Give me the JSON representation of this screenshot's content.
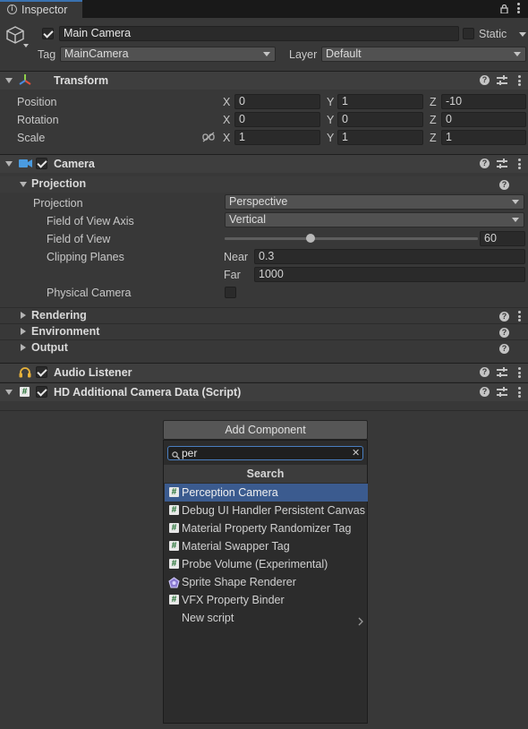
{
  "tab": {
    "title": "Inspector"
  },
  "gameobject": {
    "active": true,
    "name": "Main Camera",
    "static_label": "Static",
    "static_checked": false,
    "tag_label": "Tag",
    "tag_value": "MainCamera",
    "layer_label": "Layer",
    "layer_value": "Default"
  },
  "transform": {
    "title": "Transform",
    "rows": [
      {
        "label": "Position",
        "x": "0",
        "y": "1",
        "z": "-10"
      },
      {
        "label": "Rotation",
        "x": "0",
        "y": "0",
        "z": "0"
      },
      {
        "label": "Scale",
        "x": "1",
        "y": "1",
        "z": "1"
      }
    ],
    "axis": {
      "x": "X",
      "y": "Y",
      "z": "Z"
    }
  },
  "camera": {
    "title": "Camera",
    "enabled": true,
    "projection_section": "Projection",
    "projection_label": "Projection",
    "projection_value": "Perspective",
    "fov_axis_label": "Field of View Axis",
    "fov_axis_value": "Vertical",
    "fov_label": "Field of View",
    "fov_value": "60",
    "fov_slider_fraction": 0.339,
    "clipping_label": "Clipping Planes",
    "near_label": "Near",
    "near_value": "0.3",
    "far_label": "Far",
    "far_value": "1000",
    "physical_label": "Physical Camera",
    "physical_checked": false,
    "sections": [
      "Rendering",
      "Environment",
      "Output"
    ]
  },
  "audio_listener": {
    "title": "Audio Listener",
    "enabled": true
  },
  "hd_camera": {
    "title": "HD Additional Camera Data (Script)",
    "enabled": true
  },
  "add_component": {
    "button_label": "Add Component",
    "search_value": "per",
    "list_header": "Search",
    "items": [
      {
        "label": "Perception Camera",
        "icon": "script-icon",
        "selected": true
      },
      {
        "label": "Debug UI Handler Persistent Canvas",
        "icon": "script-icon"
      },
      {
        "label": "Material Property Randomizer Tag",
        "icon": "script-icon"
      },
      {
        "label": "Material Swapper Tag",
        "icon": "script-icon"
      },
      {
        "label": "Probe Volume (Experimental)",
        "icon": "script-icon"
      },
      {
        "label": "Sprite Shape Renderer",
        "icon": "sprite-shape-icon"
      },
      {
        "label": "VFX Property Binder",
        "icon": "script-icon"
      }
    ],
    "new_script_label": "New script"
  },
  "colors": {
    "accent": "#3b5b8f",
    "background": "#383838",
    "field": "#2a2a2a"
  }
}
